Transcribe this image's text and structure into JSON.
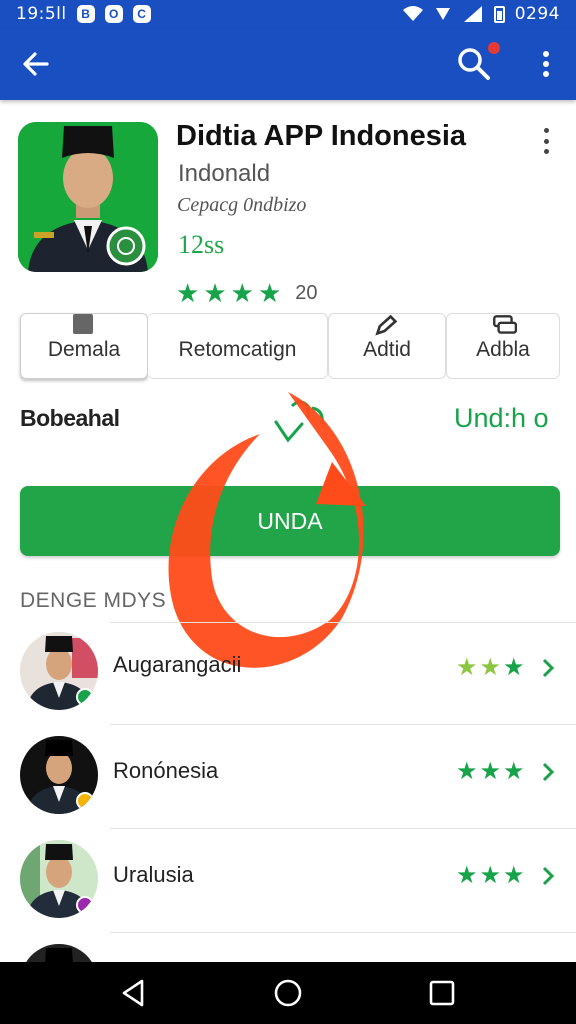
{
  "status_bar": {
    "time": "19:5ll",
    "notif_icons": [
      "B",
      "O",
      "C"
    ],
    "right_text": "0294"
  },
  "app_bar": {
    "back_icon": "arrow-left-icon",
    "search_icon": "search-icon",
    "more_icon": "more-vertical-icon",
    "colors": {
      "bar": "#1a4fc2",
      "notification_dot": "#e53935"
    }
  },
  "app": {
    "title": "Didtia APP Indonesia",
    "developer": "Indonald",
    "category": "Cepacg 0ndbizo",
    "price": "12ss",
    "rating_stars": 4,
    "rating_count": "20",
    "accent_color": "#1ea84a"
  },
  "tabs": [
    {
      "label": "Demala",
      "icon": "square-icon",
      "active": true
    },
    {
      "label": "Retomcatign",
      "icon": "",
      "active": false
    },
    {
      "label": "Adtid",
      "icon": "edit-icon",
      "active": false
    },
    {
      "label": "Adbla",
      "icon": "stack-icon",
      "active": false
    }
  ],
  "download": {
    "label": "Bobeahal",
    "status": "Und:h o",
    "icon": "download-icon"
  },
  "install_button": {
    "label": "UNDA",
    "color": "#21a548"
  },
  "section": {
    "heading": "DENGE MDYS"
  },
  "list": [
    {
      "name": "Augarangacii",
      "stars": 3,
      "star_color": "#8cc63f",
      "badge_color": "#16a34a"
    },
    {
      "name": "Ronónesia",
      "stars": 3,
      "star_color": "#16a34a",
      "badge_color": "#f4b400"
    },
    {
      "name": "Uralusia",
      "stars": 3,
      "star_color": "#16a34a",
      "badge_color": "#9b27af"
    },
    {
      "name": "",
      "stars": 0,
      "star_color": "#16a34a",
      "badge_color": "#16a34a"
    }
  ],
  "nav_bar": {
    "back": "nav-back-icon",
    "home": "nav-home-icon",
    "recents": "nav-recents-icon"
  }
}
